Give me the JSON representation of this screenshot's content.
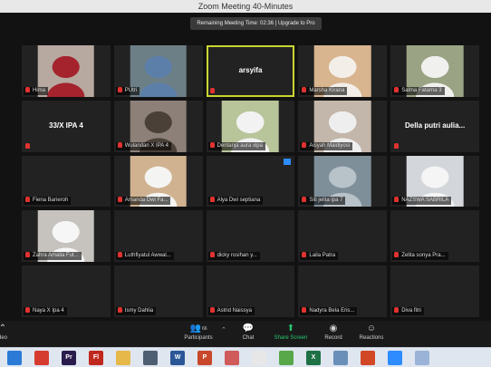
{
  "window": {
    "title": "Zoom Meeting 40-Minutes"
  },
  "banner": {
    "text": "Remaining Meeting Time: 02:36 | Upgrade to Pro"
  },
  "colors": {
    "mic_muted": "#e0322f",
    "active_speaker": "#c9d531",
    "share_green": "#29c76f"
  },
  "tiles": [
    {
      "label": "Hima",
      "kind": "video",
      "bg": "#b7a9a0",
      "fg": "#a4232d"
    },
    {
      "label": "PUtri",
      "kind": "video",
      "bg": "#6d7f86",
      "fg": "#5c7faa"
    },
    {
      "label": "",
      "kind": "name",
      "big": "arsyifa",
      "active": true
    },
    {
      "label": "Marsha Kirana",
      "kind": "video",
      "bg": "#d8b58f",
      "fg": "#f3efe8"
    },
    {
      "label": "Salma Fatarna 3",
      "kind": "video",
      "bg": "#9aa384",
      "fg": "#f0f0ee"
    },
    {
      "label": "",
      "kind": "name",
      "big": "33/X IPA 4"
    },
    {
      "label": "Wulandari X IPA 4",
      "kind": "video",
      "bg": "#8c8078",
      "fg": "#4a4038"
    },
    {
      "label": "Dentanja aura xipa",
      "kind": "video",
      "bg": "#b8c49a",
      "fg": "#f2f2f2"
    },
    {
      "label": "Aisyah Maidiyosi",
      "kind": "video",
      "bg": "#c3b6aa",
      "fg": "#eeeeee"
    },
    {
      "label": "",
      "kind": "name",
      "big": "Della putri aulia..."
    },
    {
      "label": "Fiena Barieroh",
      "kind": "blank"
    },
    {
      "label": "Amanda Dwi Fa...",
      "kind": "video",
      "bg": "#d0b290",
      "fg": "#f4f4f2"
    },
    {
      "label": "Alya Dwi septiana",
      "kind": "blank",
      "badge": true
    },
    {
      "label": "Siti jelita ipa 7",
      "kind": "video",
      "bg": "#7f8f9a",
      "fg": "#b8c2c9"
    },
    {
      "label": "NAZSWA SABRILA",
      "kind": "video",
      "bg": "#d3d6db",
      "fg": "#f5f5f5"
    },
    {
      "label": "Zahra Amalia Fut...",
      "kind": "video",
      "bg": "#c6c2bd",
      "fg": "#f6f6f6"
    },
    {
      "label": "Luthfiyatul Awwal...",
      "kind": "blank"
    },
    {
      "label": "dicky rosihan y...",
      "kind": "blank"
    },
    {
      "label": "Laila Patra",
      "kind": "blank"
    },
    {
      "label": "Zelita sonya Pra...",
      "kind": "blank"
    },
    {
      "label": "Naya X Ipa 4",
      "kind": "blank"
    },
    {
      "label": "Ismy Dahlia",
      "kind": "blank"
    },
    {
      "label": "Astrid Naissya",
      "kind": "blank"
    },
    {
      "label": "Nadyra Bela Eris...",
      "kind": "blank"
    },
    {
      "label": "Diva fitri",
      "kind": "blank"
    }
  ],
  "toolbar": {
    "participants_label": "Participants",
    "participants_count": "66",
    "chat_label": "Chat",
    "share_label": "Share Screen",
    "record_label": "Record",
    "reactions_label": "Reactions",
    "left_label": "deo"
  },
  "taskbar": [
    {
      "icon": "start-icon",
      "color": "#2c7bd6",
      "text": ""
    },
    {
      "icon": "acrobat-icon",
      "color": "#d63b2f",
      "text": ""
    },
    {
      "icon": "premiere-icon",
      "color": "#2a1b4d",
      "text": "Pr"
    },
    {
      "icon": "flash-icon",
      "color": "#c0271d",
      "text": "Fl"
    },
    {
      "icon": "folder-icon",
      "color": "#e6b84a",
      "text": ""
    },
    {
      "icon": "store-icon",
      "color": "#4f5f73",
      "text": ""
    },
    {
      "icon": "word-icon",
      "color": "#2b5797",
      "text": "W"
    },
    {
      "icon": "powerpoint-icon",
      "color": "#c8462a",
      "text": "P"
    },
    {
      "icon": "calendar-icon",
      "color": "#cf5b5b",
      "text": ""
    },
    {
      "icon": "paint-icon",
      "color": "#e7e7e7",
      "text": ""
    },
    {
      "icon": "maps-icon",
      "color": "#58a84a",
      "text": ""
    },
    {
      "icon": "excel-icon",
      "color": "#1e7145",
      "text": "X"
    },
    {
      "icon": "files-icon",
      "color": "#6a8fb8",
      "text": ""
    },
    {
      "icon": "office-icon",
      "color": "#d24726",
      "text": ""
    },
    {
      "icon": "zoom-icon",
      "color": "#2d8cff",
      "text": ""
    },
    {
      "icon": "browser-icon",
      "color": "#9ab3d6",
      "text": ""
    }
  ]
}
